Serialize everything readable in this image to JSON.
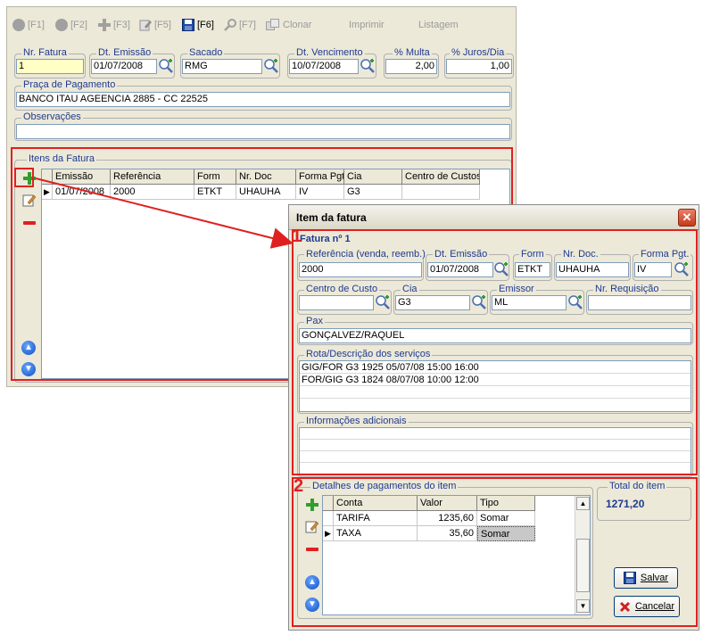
{
  "toolbar": {
    "items": [
      {
        "label": "[F1]",
        "icon": "back-icon"
      },
      {
        "label": "[F2]",
        "icon": "forward-icon"
      },
      {
        "label": "[F3]",
        "icon": "plus-icon"
      },
      {
        "label": "[F5]",
        "icon": "edit-icon"
      },
      {
        "label": "[F6]",
        "icon": "save-icon"
      },
      {
        "label": "[F7]",
        "icon": "search-icon"
      },
      {
        "label": "Clonar",
        "icon": "clone-icon"
      },
      {
        "label": "Imprimir",
        "icon": ""
      },
      {
        "label": "Listagem",
        "icon": ""
      }
    ]
  },
  "header_fields": {
    "nr_fatura": {
      "label": "Nr. Fatura",
      "value": "1"
    },
    "dt_emissao": {
      "label": "Dt. Emissão",
      "value": "01/07/2008"
    },
    "sacado": {
      "label": "Sacado",
      "value": "RMG"
    },
    "dt_vencimento": {
      "label": "Dt. Vencimento",
      "value": "10/07/2008"
    },
    "multa": {
      "label": "% Multa",
      "value": "2,00"
    },
    "juros": {
      "label": "% Juros/Dia",
      "value": "1,00"
    },
    "praca": {
      "label": "Praça de Pagamento",
      "value": "BANCO ITAU AGEENCIA 2885 - CC 22525"
    },
    "observacoes": {
      "label": "Observações",
      "value": ""
    }
  },
  "itens": {
    "legend": "Itens da Fatura",
    "columns": [
      "Emissão",
      "Referência",
      "Form",
      "Nr. Doc",
      "Forma Pgt.",
      "Cia",
      "Centro de Custos"
    ],
    "rows": [
      [
        "01/07/2008",
        "2000",
        "ETKT",
        "UHAUHA",
        "IV",
        "G3",
        ""
      ]
    ]
  },
  "callouts": {
    "one": "1",
    "two": "2"
  },
  "dialog": {
    "title": "Item da fatura",
    "fatura_label": "Fatura nº 1",
    "referencia": {
      "label": "Referência (venda, reemb.)",
      "value": "2000"
    },
    "dt_emissao": {
      "label": "Dt. Emissão",
      "value": "01/07/2008"
    },
    "form": {
      "label": "Form",
      "value": "ETKT"
    },
    "nr_doc": {
      "label": "Nr. Doc.",
      "value": "UHAUHA"
    },
    "forma_pgt": {
      "label": "Forma Pgt.",
      "value": "IV"
    },
    "centro_custo": {
      "label": "Centro de Custo",
      "value": ""
    },
    "cia": {
      "label": "Cia",
      "value": "G3"
    },
    "emissor": {
      "label": "Emissor",
      "value": "ML"
    },
    "nr_requisicao": {
      "label": "Nr. Requisição",
      "value": ""
    },
    "pax": {
      "label": "Pax",
      "value": "GONÇALVEZ/RAQUEL"
    },
    "rota": {
      "label": "Rota/Descrição dos serviços",
      "lines": [
        "GIG/FOR G3 1925 05/07/08 15:00 16:00",
        "FOR/GIG G3 1824 08/07/08 10:00 12:00",
        "",
        ""
      ]
    },
    "info": {
      "label": "Informações adicionais",
      "lines": [
        "",
        "",
        "",
        ""
      ]
    },
    "pagamentos": {
      "legend": "Detalhes de pagamentos do item",
      "columns": [
        "Conta",
        "Valor",
        "Tipo"
      ],
      "rows": [
        [
          "TARIFA",
          "1235,60",
          "Somar"
        ],
        [
          "TAXA",
          "35,60",
          "Somar"
        ]
      ]
    },
    "total": {
      "label": "Total do item",
      "value": "1271,20"
    },
    "save_label": "Salvar",
    "cancel_label": "Cancelar"
  },
  "colors": {
    "accent_red": "#e02020",
    "title_blue": "#1f3a93",
    "field_yellow": "#ffffc6"
  }
}
